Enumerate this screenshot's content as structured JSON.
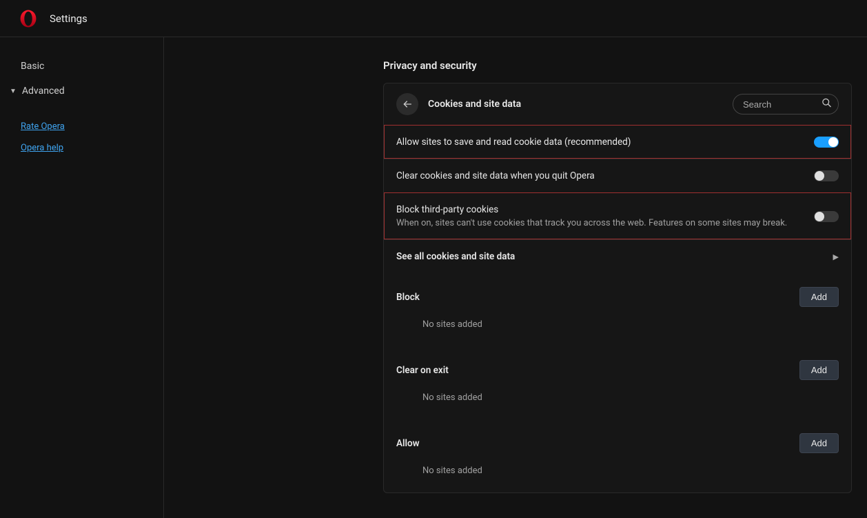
{
  "header": {
    "title": "Settings"
  },
  "sidebar": {
    "basic": "Basic",
    "advanced": "Advanced",
    "links": {
      "rate": "Rate Opera",
      "help": "Opera help"
    }
  },
  "main": {
    "section": "Privacy and security",
    "panel_title": "Cookies and site data",
    "search_placeholder": "Search",
    "rows": {
      "allow_cookies": "Allow sites to save and read cookie data (recommended)",
      "clear_on_quit": "Clear cookies and site data when you quit Opera",
      "block_third": "Block third-party cookies",
      "block_third_sub": "When on, sites can't use cookies that track you across the web. Features on some sites may break.",
      "see_all": "See all cookies and site data"
    },
    "lists": {
      "block": {
        "title": "Block",
        "add": "Add",
        "empty": "No sites added"
      },
      "clear_exit": {
        "title": "Clear on exit",
        "add": "Add",
        "empty": "No sites added"
      },
      "allow": {
        "title": "Allow",
        "add": "Add",
        "empty": "No sites added"
      }
    }
  }
}
